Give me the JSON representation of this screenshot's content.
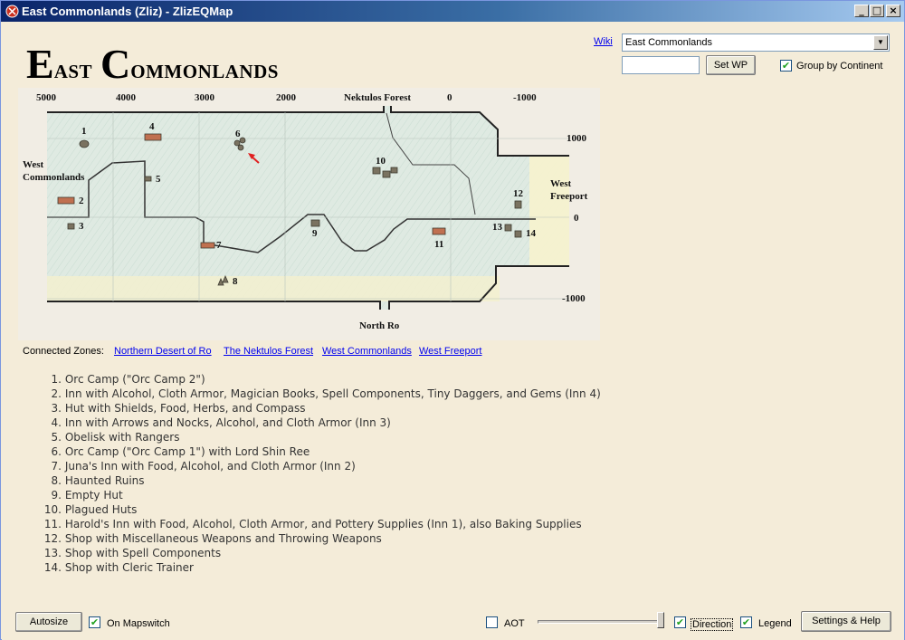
{
  "window": {
    "title": "East Commonlands (Zliz) - ZlizEQMap",
    "buttons": {
      "minimize": "_",
      "maximize": "□",
      "close": "×"
    }
  },
  "header": {
    "title_word1_initial": "E",
    "title_word1_rest": "AST",
    "title_word2_initial": "C",
    "title_word2_rest": "OMMONLANDS",
    "wiki_label": "Wiki",
    "zone_select_value": "East Commonlands",
    "waypoint_input_value": "",
    "set_wp_label": "Set WP",
    "group_by_continent_label": "Group by Continent",
    "group_by_continent_checked": true
  },
  "map": {
    "x_axis_labels": [
      "5000",
      "4000",
      "3000",
      "2000",
      "0",
      "-1000"
    ],
    "y_axis_labels": [
      "1000",
      "0",
      "-1000"
    ],
    "region_labels": {
      "nektulos_forest": "Nektulos Forest",
      "west_commonlands_line1": "West",
      "west_commonlands_line2": "Commonlands",
      "west_freeport_line1": "West",
      "west_freeport_line2": "Freeport",
      "north_ro": "North Ro"
    },
    "markers": [
      "1",
      "2",
      "3",
      "4",
      "5",
      "6",
      "7",
      "8",
      "9",
      "10",
      "11",
      "12",
      "13",
      "14"
    ],
    "player_arrow_color": "#e02020"
  },
  "connected_zones": {
    "label": "Connected Zones:",
    "links": [
      "Northern Desert of Ro",
      "The Nektulos Forest",
      "West Commonlands",
      "West Freeport"
    ]
  },
  "legend": [
    {
      "n": "1.",
      "text": "Orc Camp (\"Orc Camp 2\")"
    },
    {
      "n": "2.",
      "text": "Inn with Alcohol, Cloth Armor, Magician Books, Spell Components, Tiny Daggers, and Gems (Inn 4)"
    },
    {
      "n": "3.",
      "text": "Hut with Shields, Food, Herbs, and Compass"
    },
    {
      "n": "4.",
      "text": "Inn with Arrows and Nocks, Alcohol, and Cloth Armor (Inn 3)"
    },
    {
      "n": "5.",
      "text": "Obelisk with Rangers"
    },
    {
      "n": "6.",
      "text": "Orc Camp (\"Orc Camp 1\") with Lord Shin Ree"
    },
    {
      "n": "7.",
      "text": "Juna's Inn with Food, Alcohol, and Cloth Armor (Inn 2)"
    },
    {
      "n": "8.",
      "text": "Haunted Ruins"
    },
    {
      "n": "9.",
      "text": "Empty Hut"
    },
    {
      "n": "10.",
      "text": "Plagued Huts"
    },
    {
      "n": "11.",
      "text": "Harold's Inn with Food, Alcohol, Cloth Armor, and Pottery Supplies (Inn 1), also Baking Supplies"
    },
    {
      "n": "12.",
      "text": "Shop with Miscellaneous Weapons and Throwing Weapons"
    },
    {
      "n": "13.",
      "text": "Shop with Spell Components"
    },
    {
      "n": "14.",
      "text": "Shop with Cleric Trainer"
    }
  ],
  "footer": {
    "autosize_label": "Autosize",
    "on_mapswitch_label": "On Mapswitch",
    "on_mapswitch_checked": true,
    "aot_label": "AOT",
    "aot_checked": false,
    "opacity_slider_value": 1.0,
    "direction_label": "Direction",
    "direction_checked": true,
    "legend_label": "Legend",
    "legend_checked": true,
    "settings_label": "Settings & Help"
  }
}
